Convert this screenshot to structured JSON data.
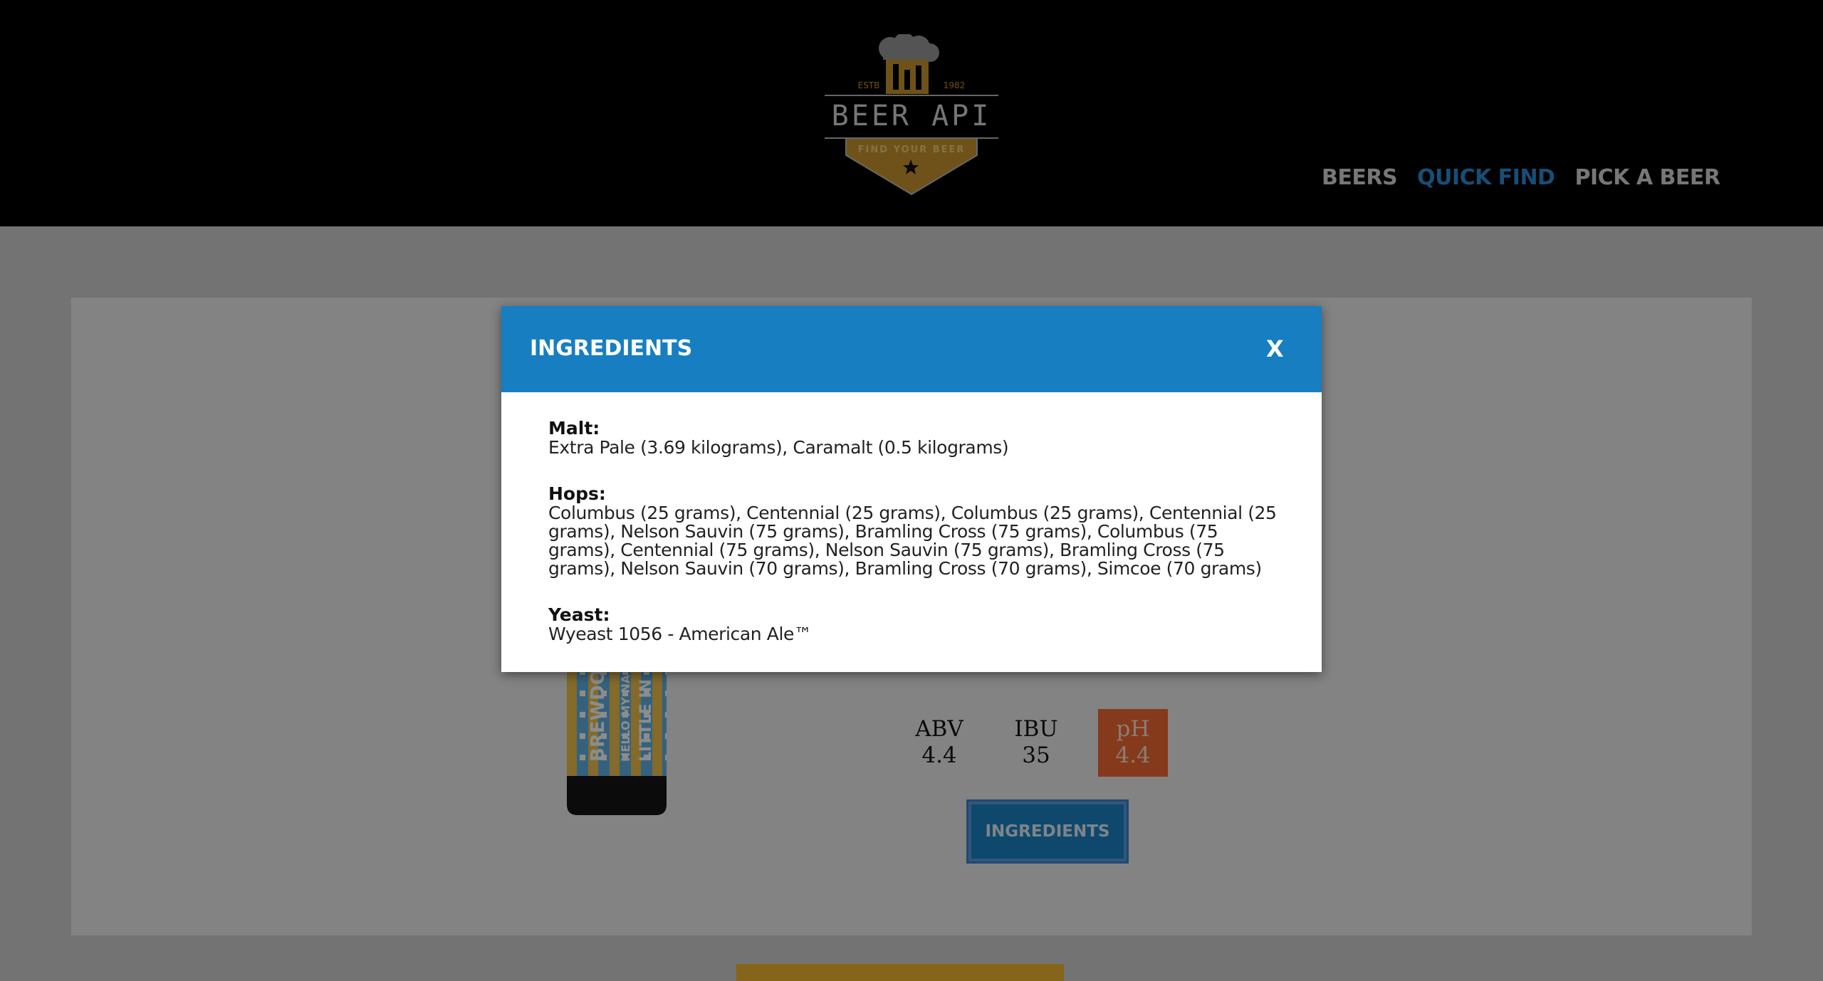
{
  "header": {
    "logo": {
      "estb_left": "ESTB",
      "estb_right": "1982",
      "name": "BEER API",
      "tagline": "FIND YOUR BEER",
      "icon": "beer-mug-icon"
    },
    "nav": [
      {
        "label": "BEERS"
      },
      {
        "label": "QUICK FIND"
      },
      {
        "label": "PICK A BEER"
      }
    ],
    "active_nav": "QUICK FIND"
  },
  "beer": {
    "image_icon": "beer-can-image",
    "can_text": [
      "BREWDOG",
      "HELLO MY NA",
      "LITTLE IN"
    ],
    "stats": [
      {
        "label": "ABV",
        "value": "4.4"
      },
      {
        "label": "IBU",
        "value": "35"
      },
      {
        "label": "pH",
        "value": "4.4"
      }
    ],
    "ingredients_button": "INGREDIENTS"
  },
  "modal": {
    "title": "INGREDIENTS",
    "close_label": "X",
    "sections": [
      {
        "label": "Malt:",
        "text": "Extra Pale (3.69 kilograms), Caramalt (0.5 kilograms)"
      },
      {
        "label": "Hops:",
        "text": "Columbus (25 grams), Centennial (25 grams), Columbus (25 grams), Centennial (25 grams), Nelson Sauvin (75 grams), Bramling Cross (75 grams), Columbus (75 grams), Centennial (75 grams), Nelson Sauvin (75 grams), Bramling Cross (75 grams), Nelson Sauvin (70 grams), Bramling Cross (70 grams), Simcoe (70 grams)"
      },
      {
        "label": "Yeast:",
        "text": "Wyeast 1056 - American Ale™"
      }
    ]
  },
  "colors": {
    "header_bg": "#000000",
    "accent_blue": "#177ec1",
    "nav_active": "#2b8ed8",
    "ph_highlight": "#f26b32",
    "logo_gold": "#c8962e",
    "bottom_bar": "#f0b92f"
  }
}
